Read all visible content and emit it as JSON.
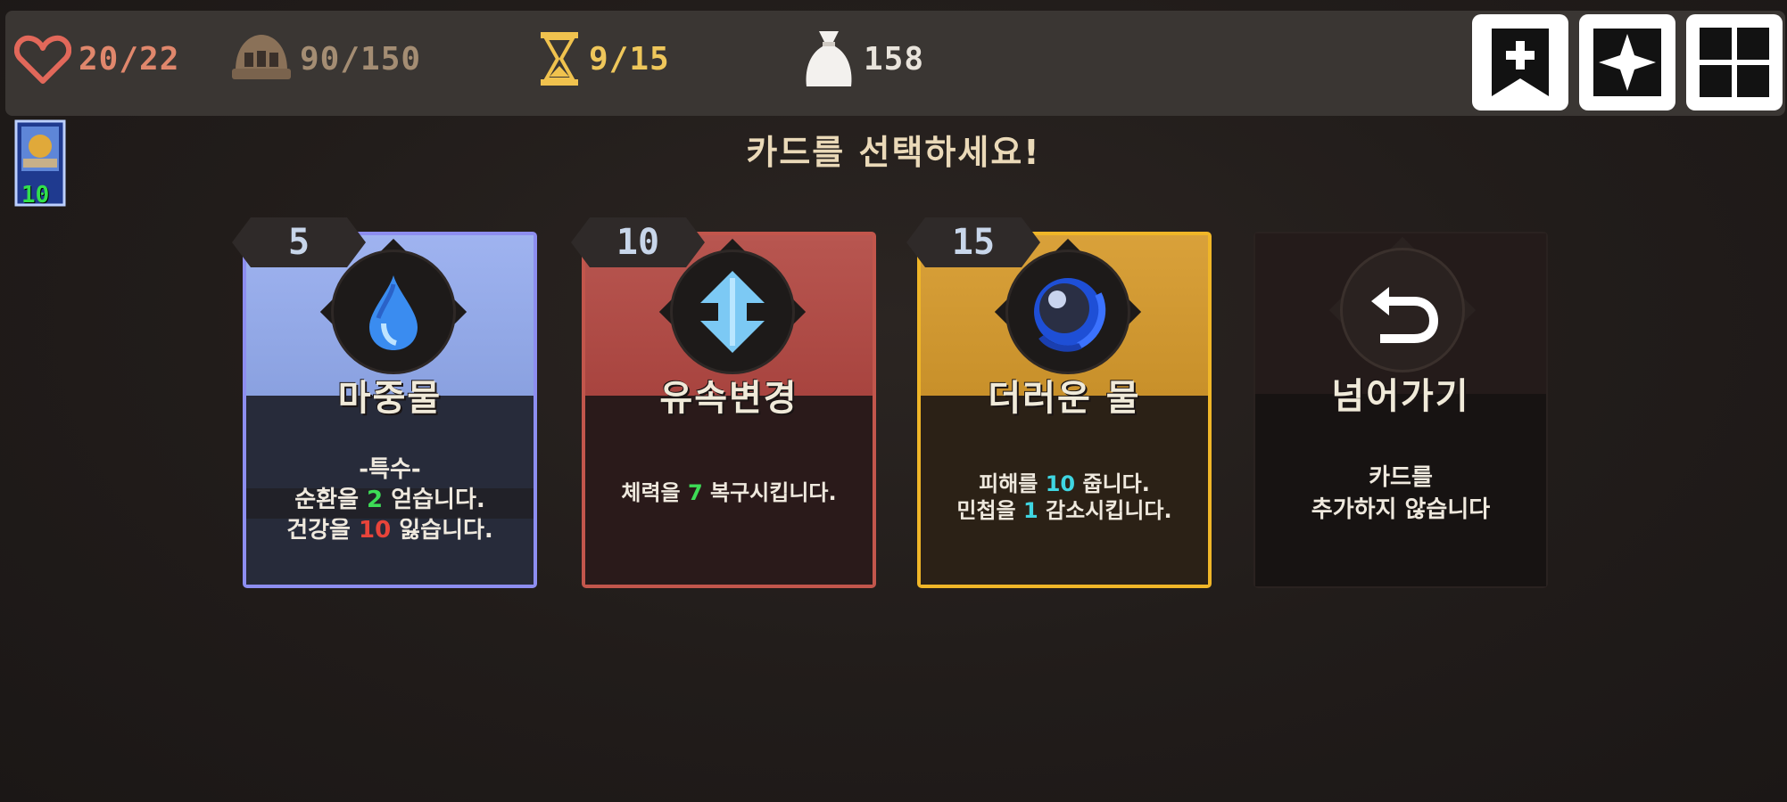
{
  "topbar": {
    "hp": "20/22",
    "armor": "90/150",
    "time": "9/15",
    "gold": "158",
    "buttons": [
      "bookmark-add-icon",
      "sparkle-icon",
      "grid-menu-icon"
    ]
  },
  "deck": {
    "count": "10"
  },
  "prompt": "카드를 선택하세요!",
  "cards": [
    {
      "cost": "5",
      "name": "마중물",
      "tag": "-특수-",
      "line1_a": "순환을 ",
      "line1_num": "2",
      "line1_b": " 얻습니다.",
      "line2_a": "건강을 ",
      "line2_num": "10",
      "line2_b": " 잃습니다."
    },
    {
      "cost": "10",
      "name": "유속변경",
      "line1_a": "체력을 ",
      "line1_num": "7",
      "line1_b": " 복구시킵니다."
    },
    {
      "cost": "15",
      "name": "더러운 물",
      "line1_a": "피해를 ",
      "line1_num": "10",
      "line1_b": " 줍니다.",
      "line2_a": "민첩을 ",
      "line2_num": "1",
      "line2_b": " 감소시킵니다."
    },
    {
      "name": "넘어가기",
      "line1": "카드를",
      "line2": "추가하지 않습니다"
    }
  ],
  "colors": {
    "card1": "#8ea7e3",
    "card2": "#b2524f",
    "card3": "#d39a2a",
    "skip": "#1a1615",
    "hp": "#e0876c",
    "armor": "#a48d73",
    "time": "#efc75b"
  }
}
